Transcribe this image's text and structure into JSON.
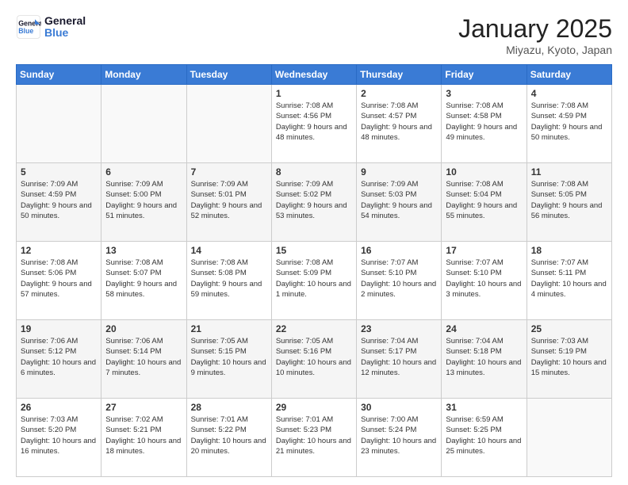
{
  "logo": {
    "text_general": "General",
    "text_blue": "Blue"
  },
  "title": {
    "month_year": "January 2025",
    "location": "Miyazu, Kyoto, Japan"
  },
  "weekdays": [
    "Sunday",
    "Monday",
    "Tuesday",
    "Wednesday",
    "Thursday",
    "Friday",
    "Saturday"
  ],
  "weeks": [
    [
      {
        "day": "",
        "content": ""
      },
      {
        "day": "",
        "content": ""
      },
      {
        "day": "",
        "content": ""
      },
      {
        "day": "1",
        "content": "Sunrise: 7:08 AM\nSunset: 4:56 PM\nDaylight: 9 hours and 48 minutes."
      },
      {
        "day": "2",
        "content": "Sunrise: 7:08 AM\nSunset: 4:57 PM\nDaylight: 9 hours and 48 minutes."
      },
      {
        "day": "3",
        "content": "Sunrise: 7:08 AM\nSunset: 4:58 PM\nDaylight: 9 hours and 49 minutes."
      },
      {
        "day": "4",
        "content": "Sunrise: 7:08 AM\nSunset: 4:59 PM\nDaylight: 9 hours and 50 minutes."
      }
    ],
    [
      {
        "day": "5",
        "content": "Sunrise: 7:09 AM\nSunset: 4:59 PM\nDaylight: 9 hours and 50 minutes."
      },
      {
        "day": "6",
        "content": "Sunrise: 7:09 AM\nSunset: 5:00 PM\nDaylight: 9 hours and 51 minutes."
      },
      {
        "day": "7",
        "content": "Sunrise: 7:09 AM\nSunset: 5:01 PM\nDaylight: 9 hours and 52 minutes."
      },
      {
        "day": "8",
        "content": "Sunrise: 7:09 AM\nSunset: 5:02 PM\nDaylight: 9 hours and 53 minutes."
      },
      {
        "day": "9",
        "content": "Sunrise: 7:09 AM\nSunset: 5:03 PM\nDaylight: 9 hours and 54 minutes."
      },
      {
        "day": "10",
        "content": "Sunrise: 7:08 AM\nSunset: 5:04 PM\nDaylight: 9 hours and 55 minutes."
      },
      {
        "day": "11",
        "content": "Sunrise: 7:08 AM\nSunset: 5:05 PM\nDaylight: 9 hours and 56 minutes."
      }
    ],
    [
      {
        "day": "12",
        "content": "Sunrise: 7:08 AM\nSunset: 5:06 PM\nDaylight: 9 hours and 57 minutes."
      },
      {
        "day": "13",
        "content": "Sunrise: 7:08 AM\nSunset: 5:07 PM\nDaylight: 9 hours and 58 minutes."
      },
      {
        "day": "14",
        "content": "Sunrise: 7:08 AM\nSunset: 5:08 PM\nDaylight: 9 hours and 59 minutes."
      },
      {
        "day": "15",
        "content": "Sunrise: 7:08 AM\nSunset: 5:09 PM\nDaylight: 10 hours and 1 minute."
      },
      {
        "day": "16",
        "content": "Sunrise: 7:07 AM\nSunset: 5:10 PM\nDaylight: 10 hours and 2 minutes."
      },
      {
        "day": "17",
        "content": "Sunrise: 7:07 AM\nSunset: 5:10 PM\nDaylight: 10 hours and 3 minutes."
      },
      {
        "day": "18",
        "content": "Sunrise: 7:07 AM\nSunset: 5:11 PM\nDaylight: 10 hours and 4 minutes."
      }
    ],
    [
      {
        "day": "19",
        "content": "Sunrise: 7:06 AM\nSunset: 5:12 PM\nDaylight: 10 hours and 6 minutes."
      },
      {
        "day": "20",
        "content": "Sunrise: 7:06 AM\nSunset: 5:14 PM\nDaylight: 10 hours and 7 minutes."
      },
      {
        "day": "21",
        "content": "Sunrise: 7:05 AM\nSunset: 5:15 PM\nDaylight: 10 hours and 9 minutes."
      },
      {
        "day": "22",
        "content": "Sunrise: 7:05 AM\nSunset: 5:16 PM\nDaylight: 10 hours and 10 minutes."
      },
      {
        "day": "23",
        "content": "Sunrise: 7:04 AM\nSunset: 5:17 PM\nDaylight: 10 hours and 12 minutes."
      },
      {
        "day": "24",
        "content": "Sunrise: 7:04 AM\nSunset: 5:18 PM\nDaylight: 10 hours and 13 minutes."
      },
      {
        "day": "25",
        "content": "Sunrise: 7:03 AM\nSunset: 5:19 PM\nDaylight: 10 hours and 15 minutes."
      }
    ],
    [
      {
        "day": "26",
        "content": "Sunrise: 7:03 AM\nSunset: 5:20 PM\nDaylight: 10 hours and 16 minutes."
      },
      {
        "day": "27",
        "content": "Sunrise: 7:02 AM\nSunset: 5:21 PM\nDaylight: 10 hours and 18 minutes."
      },
      {
        "day": "28",
        "content": "Sunrise: 7:01 AM\nSunset: 5:22 PM\nDaylight: 10 hours and 20 minutes."
      },
      {
        "day": "29",
        "content": "Sunrise: 7:01 AM\nSunset: 5:23 PM\nDaylight: 10 hours and 21 minutes."
      },
      {
        "day": "30",
        "content": "Sunrise: 7:00 AM\nSunset: 5:24 PM\nDaylight: 10 hours and 23 minutes."
      },
      {
        "day": "31",
        "content": "Sunrise: 6:59 AM\nSunset: 5:25 PM\nDaylight: 10 hours and 25 minutes."
      },
      {
        "day": "",
        "content": ""
      }
    ]
  ]
}
